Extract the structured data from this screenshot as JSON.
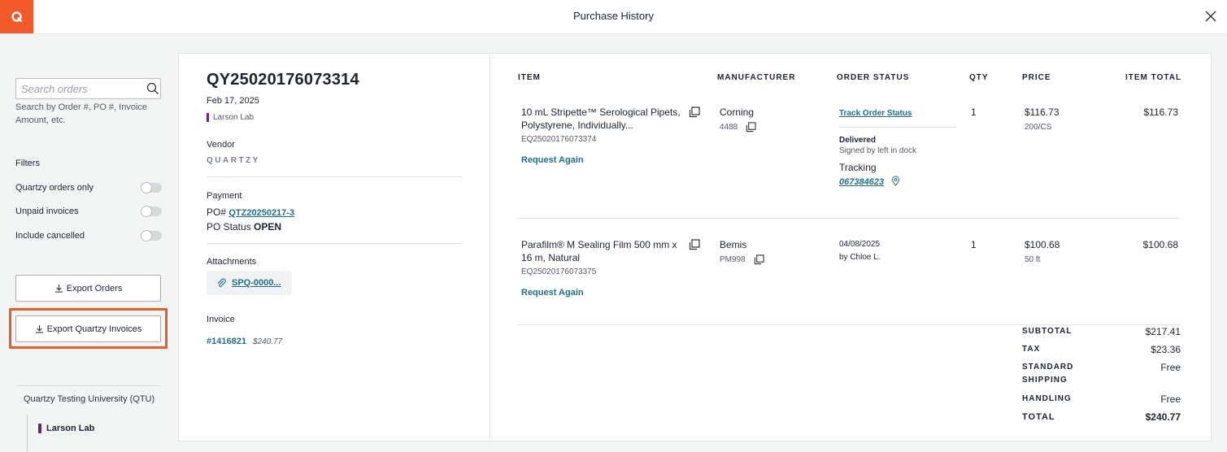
{
  "header": {
    "logo_letter": "Q",
    "title": "Purchase History"
  },
  "sidebar": {
    "search": {
      "placeholder": "Search orders",
      "value": ""
    },
    "search_hint": "Search by Order #, PO #, Invoice Amount, etc.",
    "filters_title": "Filters",
    "filters": [
      {
        "label": "Quartzy orders only",
        "on": false
      },
      {
        "label": "Unpaid invoices",
        "on": false
      },
      {
        "label": "Include cancelled",
        "on": false
      }
    ],
    "export_orders_label": "Export Orders",
    "export_invoices_label": "Export Quartzy Invoices",
    "org_name": "Quartzy Testing University (QTU)",
    "lab_name": "Larson Lab"
  },
  "order": {
    "id": "QY25020176073314",
    "date": "Feb 17, 2025",
    "lab": "Larson Lab",
    "vendor_label": "Vendor",
    "vendor_name": "QUARTZY",
    "payment_label": "Payment",
    "po_prefix": "PO#",
    "po_number": "QTZ20250217-3",
    "po_status_prefix": "PO Status",
    "po_status": "OPEN",
    "attachments_label": "Attachments",
    "attachment_name": "SPQ-0000...",
    "invoice_label": "Invoice",
    "invoice_number": "#1416821",
    "invoice_amount": "$240.77"
  },
  "table": {
    "headers": {
      "item": "ITEM",
      "manufacturer": "MANUFACTURER",
      "order_status": "ORDER STATUS",
      "qty": "QTY",
      "price": "PRICE",
      "item_total": "ITEM TOTAL"
    },
    "rows": [
      {
        "name_line1": "10 mL Stripette™ Serological Pipets,",
        "name_line2": "Polystyrene, Individually...",
        "sku": "EQ25020176073374",
        "request_again": "Request Again",
        "manufacturer": "Corning",
        "mfr_part": "4488",
        "track_link": "Track Order Status",
        "status": "Delivered",
        "status_detail": "Signed by left in dock",
        "tracking_label": "Tracking",
        "tracking_number": "067384623",
        "qty": "1",
        "price": "$116.73",
        "unit": "200/CS",
        "total": "$116.73"
      },
      {
        "name_line1": "Parafilm® M Sealing Film 500 mm x",
        "name_line2": "16 m, Natural",
        "sku": "EQ25020176073375",
        "request_again": "Request Again",
        "manufacturer": "Bemis",
        "mfr_part": "PM998",
        "status_date": "04/08/2025",
        "status_by": "by Chloe L.",
        "qty": "1",
        "price": "$100.68",
        "unit": "50 ft",
        "total": "$100.68"
      }
    ]
  },
  "summary": {
    "subtotal_label": "SUBTOTAL",
    "subtotal": "$217.41",
    "tax_label": "TAX",
    "tax": "$23.36",
    "shipping_label_1": "STANDARD",
    "shipping_label_2": "SHIPPING",
    "shipping": "Free",
    "handling_label": "HANDLING",
    "handling": "Free",
    "total_label": "TOTAL",
    "total": "$240.77"
  },
  "colors": {
    "brand": "#f15a2b",
    "link": "#1f6f8b",
    "lab_marker": "#6a2a61"
  }
}
